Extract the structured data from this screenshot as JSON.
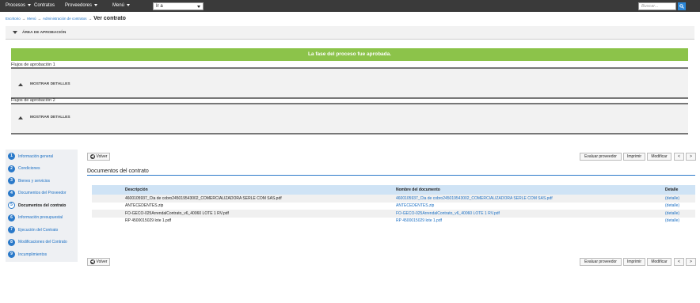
{
  "topbar": {
    "menus": [
      "Procesos",
      "Contratos",
      "Proveedores",
      "Menú"
    ],
    "goto_value": "Ir a",
    "search_placeholder": "Buscar..."
  },
  "breadcrumb": {
    "items": [
      "Escritorio",
      "Menú",
      "Administración de contratos"
    ],
    "current": "Ver contrato"
  },
  "approval": {
    "header_label": "ÁREA DE APROBACIÓN",
    "banner": "La fase del proceso fue aprobada.",
    "flows": [
      {
        "title": "Flujos de aprobación 1",
        "toggle": "MOSTRAR DETALLES"
      },
      {
        "title": "Flujos de aprobación 2",
        "toggle": "MOSTRAR DETALLES"
      }
    ]
  },
  "sidebar": {
    "items": [
      {
        "num": "1",
        "label": "Información general"
      },
      {
        "num": "2",
        "label": "Condiciones"
      },
      {
        "num": "3",
        "label": "Bienes y servicios"
      },
      {
        "num": "4",
        "label": "Documentos del Proveedor"
      },
      {
        "num": "5",
        "label": "Documentos del contrato"
      },
      {
        "num": "6",
        "label": "Información presupuestal"
      },
      {
        "num": "7",
        "label": "Ejecución del Contrato"
      },
      {
        "num": "8",
        "label": "Modificaciones del Contrato"
      },
      {
        "num": "9",
        "label": "Incumplimientos"
      }
    ],
    "active_index": 4
  },
  "actions": {
    "back": "Volver",
    "evaluate": "Evaluar proveedor",
    "print": "Imprimir",
    "modify": "Modificar",
    "prev": "<",
    "next": ">"
  },
  "section": {
    "title": "Documentos del contrato"
  },
  "table": {
    "headers": [
      "Descripción",
      "Nombre del documento",
      "Detalle"
    ],
    "rows": [
      [
        "4600105937_Cta de cobro245019543002_COMERCIALIZADORA SERLE COM SAS.pdf",
        "4600105937_Cta de cobro245019543002_COMERCIALIZADORA SERLE COM SAS.pdf",
        "(detalle)"
      ],
      [
        "ANTECEDENTES.zip",
        "ANTECEDENTES.zip",
        "(detalle)"
      ],
      [
        "FO-GECO-025ArrendalContrato_v6_40060 LOTE 1 RV.pdf",
        "FO-GECO-025ArrendalContrato_v6_40060 LOTE 1 RV.pdf",
        "(detalle)"
      ],
      [
        "RP 4500015029 lote 1.pdf",
        "RP 4500015029 lote 1.pdf",
        "(detalle)"
      ]
    ]
  }
}
